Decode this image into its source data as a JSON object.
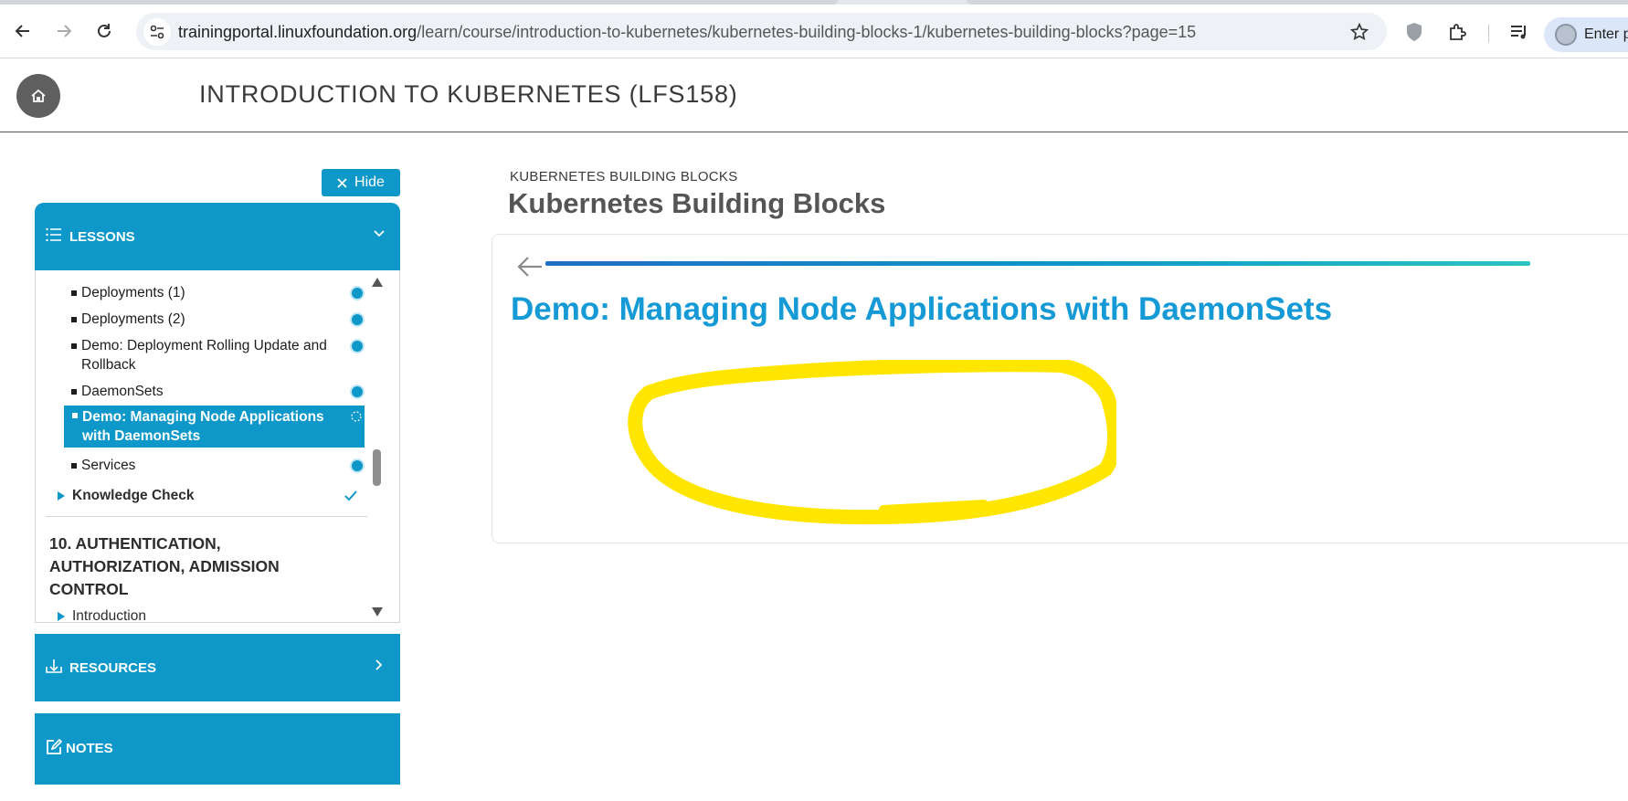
{
  "browser": {
    "url_host": "trainingportal.linuxfoundation.org",
    "url_path": "/learn/course/introduction-to-kubernetes/kubernetes-building-blocks-1/kubernetes-building-blocks?page=15",
    "profile_label": "Enter p",
    "icons": [
      "back-arrow-icon",
      "forward-arrow-icon",
      "reload-icon",
      "site-settings-icon",
      "bookmark-star-icon",
      "shield-extension-icon",
      "puzzle-extensions-icon",
      "media-controls-icon",
      "profile-avatar"
    ]
  },
  "header": {
    "course_title": "INTRODUCTION TO KUBERNETES (LFS158)"
  },
  "sidebar": {
    "hide_label": "Hide",
    "lessons_label": "LESSONS",
    "items": [
      {
        "label": "Deployments (1)",
        "status": "complete"
      },
      {
        "label": "Deployments (2)",
        "status": "complete"
      },
      {
        "label": "Demo: Deployment Rolling Update and Rollback",
        "status": "complete"
      },
      {
        "label": "DaemonSets",
        "status": "complete"
      },
      {
        "label": "Demo: Managing Node Applications with DaemonSets",
        "status": "current"
      },
      {
        "label": "Services",
        "status": "complete"
      }
    ],
    "knowledge_check_label": "Knowledge Check",
    "section_title": "10. AUTHENTICATION, AUTHORIZATION, ADMISSION CONTROL",
    "next_item_label": "Introduction",
    "resources_label": "RESOURCES",
    "notes_label": "NOTES"
  },
  "main": {
    "breadcrumb": "KUBERNETES BUILDING BLOCKS",
    "page_title": "Kubernetes Building Blocks",
    "slide_title": "Demo: Managing Node Applications with DaemonSets"
  },
  "colors": {
    "accent": "#0e98c9",
    "slide_title": "#159ad6",
    "highlight_scribble": "#ffe600"
  }
}
